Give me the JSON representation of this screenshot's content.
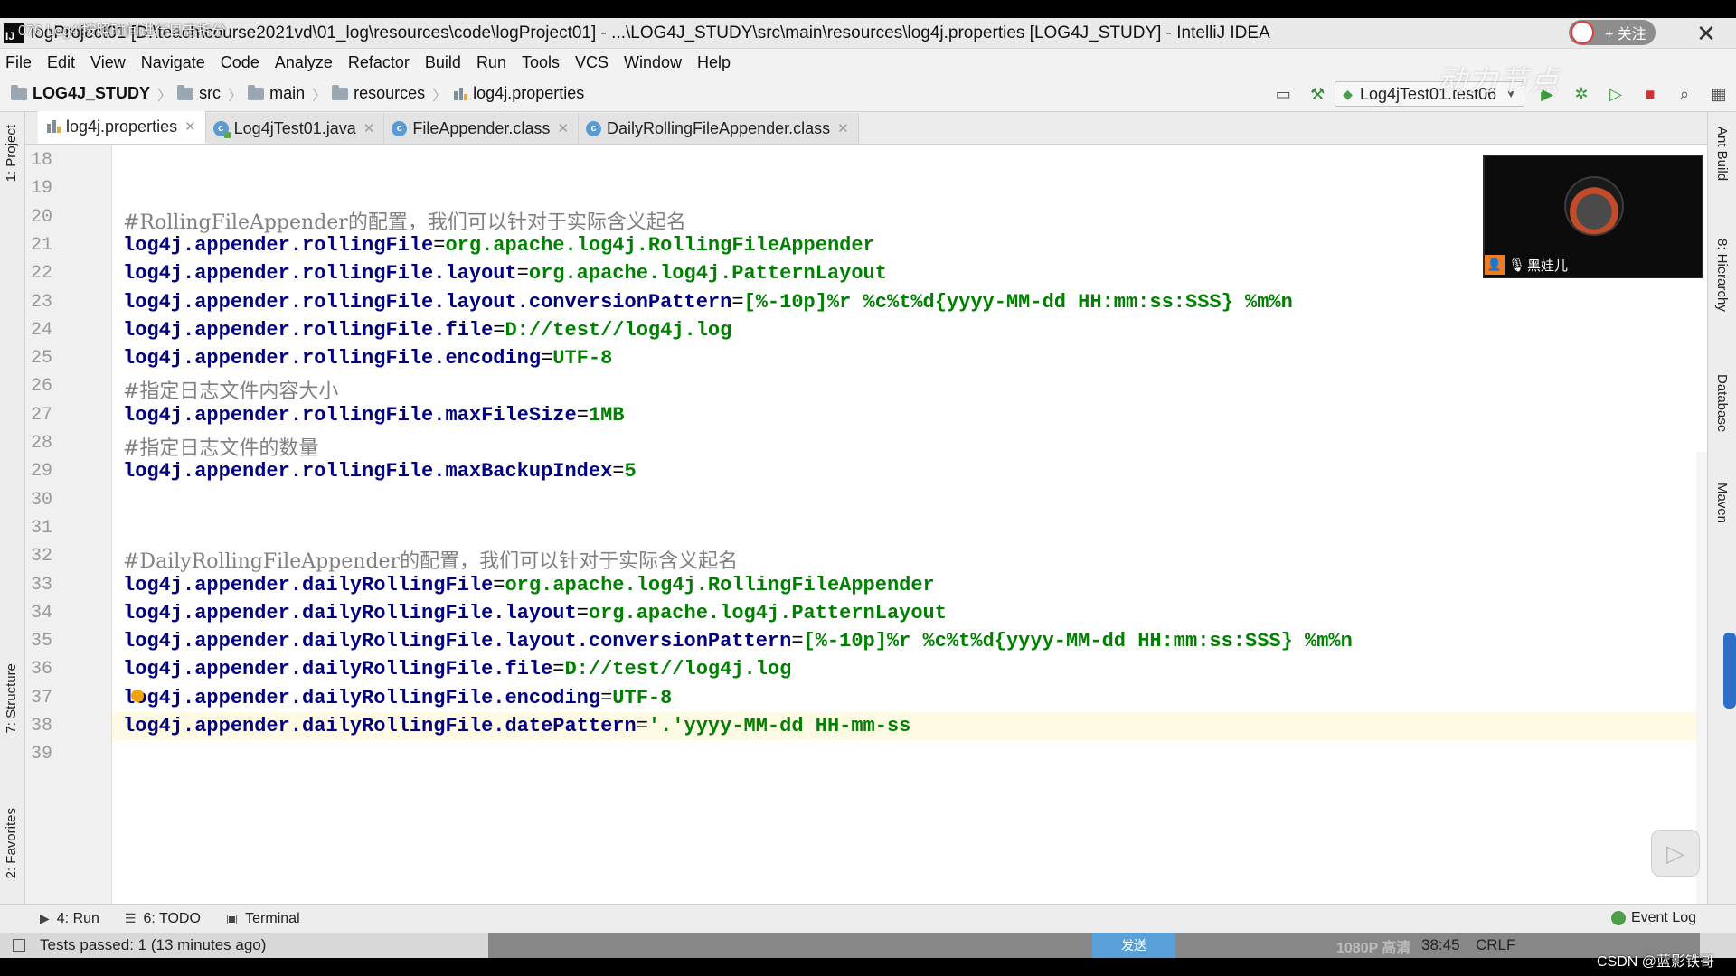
{
  "window": {
    "title": "logProject01 [D:\\teach\\course2021vd\\01_log\\resources\\code\\logProject01] - ...\\LOG4J_STUDY\\src\\main\\resources\\log4j.properties [LOG4J_STUDY] - IntelliJ IDEA",
    "app_logo": "IJ",
    "overlay_title": "076.Log4j按照时间进行日志拆分"
  },
  "video_controls": {
    "follow_label": "+ 关注",
    "close_glyph": "✕"
  },
  "menu": [
    "File",
    "Edit",
    "View",
    "Navigate",
    "Code",
    "Analyze",
    "Refactor",
    "Build",
    "Run",
    "Tools",
    "VCS",
    "Window",
    "Help"
  ],
  "breadcrumb": {
    "project": "LOG4J_STUDY",
    "folders": [
      "src",
      "main",
      "resources"
    ],
    "file": "log4j.properties"
  },
  "run_config": {
    "label": "Log4jTest01.test06"
  },
  "watermark": "动力节点",
  "left_tool_tabs": {
    "project": "1: Project",
    "structure": "7: Structure",
    "favorites": "2: Favorites"
  },
  "right_tool_tabs": {
    "ant": "Ant Build",
    "hierarchy": "8: Hierarchy",
    "database": "Database",
    "maven": "Maven"
  },
  "tabs": [
    {
      "label": "log4j.properties",
      "icon": "properties-file-icon",
      "active": true
    },
    {
      "label": "Log4jTest01.java",
      "icon": "java-class-icon",
      "active": false
    },
    {
      "label": "FileAppender.class",
      "icon": "class-file-icon",
      "active": false
    },
    {
      "label": "DailyRollingFileAppender.class",
      "icon": "class-file-icon",
      "active": false
    }
  ],
  "code": {
    "lines": [
      {
        "n": "18",
        "key": "",
        "val": "",
        "comment": ""
      },
      {
        "n": "19",
        "key": "",
        "val": "",
        "comment": ""
      },
      {
        "n": "20",
        "key": "",
        "val": "",
        "comment": "#RollingFileAppender的配置，我们可以针对于实际含义起名"
      },
      {
        "n": "21",
        "key": "log4j.appender.rollingFile",
        "val": "org.apache.log4j.RollingFileAppender",
        "comment": ""
      },
      {
        "n": "22",
        "key": "log4j.appender.rollingFile.layout",
        "val": "org.apache.log4j.PatternLayout",
        "comment": ""
      },
      {
        "n": "23",
        "key": "log4j.appender.rollingFile.layout.conversionPattern",
        "val": "[%-10p]%r %c%t%d{yyyy-MM-dd HH:mm:ss:SSS} %m%n",
        "comment": ""
      },
      {
        "n": "24",
        "key": "log4j.appender.rollingFile.file",
        "val": "D://test//log4j.log",
        "comment": ""
      },
      {
        "n": "25",
        "key": "log4j.appender.rollingFile.encoding",
        "val": "UTF-8",
        "comment": ""
      },
      {
        "n": "26",
        "key": "",
        "val": "",
        "comment": "#指定日志文件内容大小"
      },
      {
        "n": "27",
        "key": "log4j.appender.rollingFile.maxFileSize",
        "val": "1MB",
        "comment": ""
      },
      {
        "n": "28",
        "key": "",
        "val": "",
        "comment": "#指定日志文件的数量"
      },
      {
        "n": "29",
        "key": "log4j.appender.rollingFile.maxBackupIndex",
        "val": "5",
        "comment": ""
      },
      {
        "n": "30",
        "key": "",
        "val": "",
        "comment": ""
      },
      {
        "n": "31",
        "key": "",
        "val": "",
        "comment": ""
      },
      {
        "n": "32",
        "key": "",
        "val": "",
        "comment": "#DailyRollingFileAppender的配置，我们可以针对于实际含义起名"
      },
      {
        "n": "33",
        "key": "log4j.appender.dailyRollingFile",
        "val": "org.apache.log4j.RollingFileAppender",
        "comment": ""
      },
      {
        "n": "34",
        "key": "log4j.appender.dailyRollingFile.layout",
        "val": "org.apache.log4j.PatternLayout",
        "comment": ""
      },
      {
        "n": "35",
        "key": "log4j.appender.dailyRollingFile.layout.conversionPattern",
        "val": "[%-10p]%r %c%t%d{yyyy-MM-dd HH:mm:ss:SSS} %m%n",
        "comment": ""
      },
      {
        "n": "36",
        "key": "log4j.appender.dailyRollingFile.file",
        "val": "D://test//log4j.log",
        "comment": ""
      },
      {
        "n": "37",
        "key": "log4j.appender.dailyRollingFile.encoding",
        "val": "UTF-8",
        "comment": ""
      },
      {
        "n": "38",
        "key": "log4j.appender.dailyRollingFile.datePattern",
        "val": "'.'yyyy-MM-dd HH-mm-ss",
        "comment": ""
      },
      {
        "n": "39",
        "key": "",
        "val": "",
        "comment": ""
      }
    ],
    "current_line": "38",
    "bulb_line": "37"
  },
  "webcam": {
    "name": "黑娃儿"
  },
  "bottom_tools": {
    "run": "4: Run",
    "todo": "6: TODO",
    "terminal": "Terminal",
    "event_log": "Event Log"
  },
  "status": {
    "tests": "Tests passed: 1 (13 minutes ago)",
    "caret": "38:45",
    "line_sep": "CRLF",
    "quality": "1080P 高清",
    "send": "发送",
    "credit": "CSDN @蓝影铁哥"
  },
  "colors": {
    "key": "#000080",
    "value": "#008000",
    "comment": "#808080",
    "current_line_bg": "#fffae3"
  }
}
